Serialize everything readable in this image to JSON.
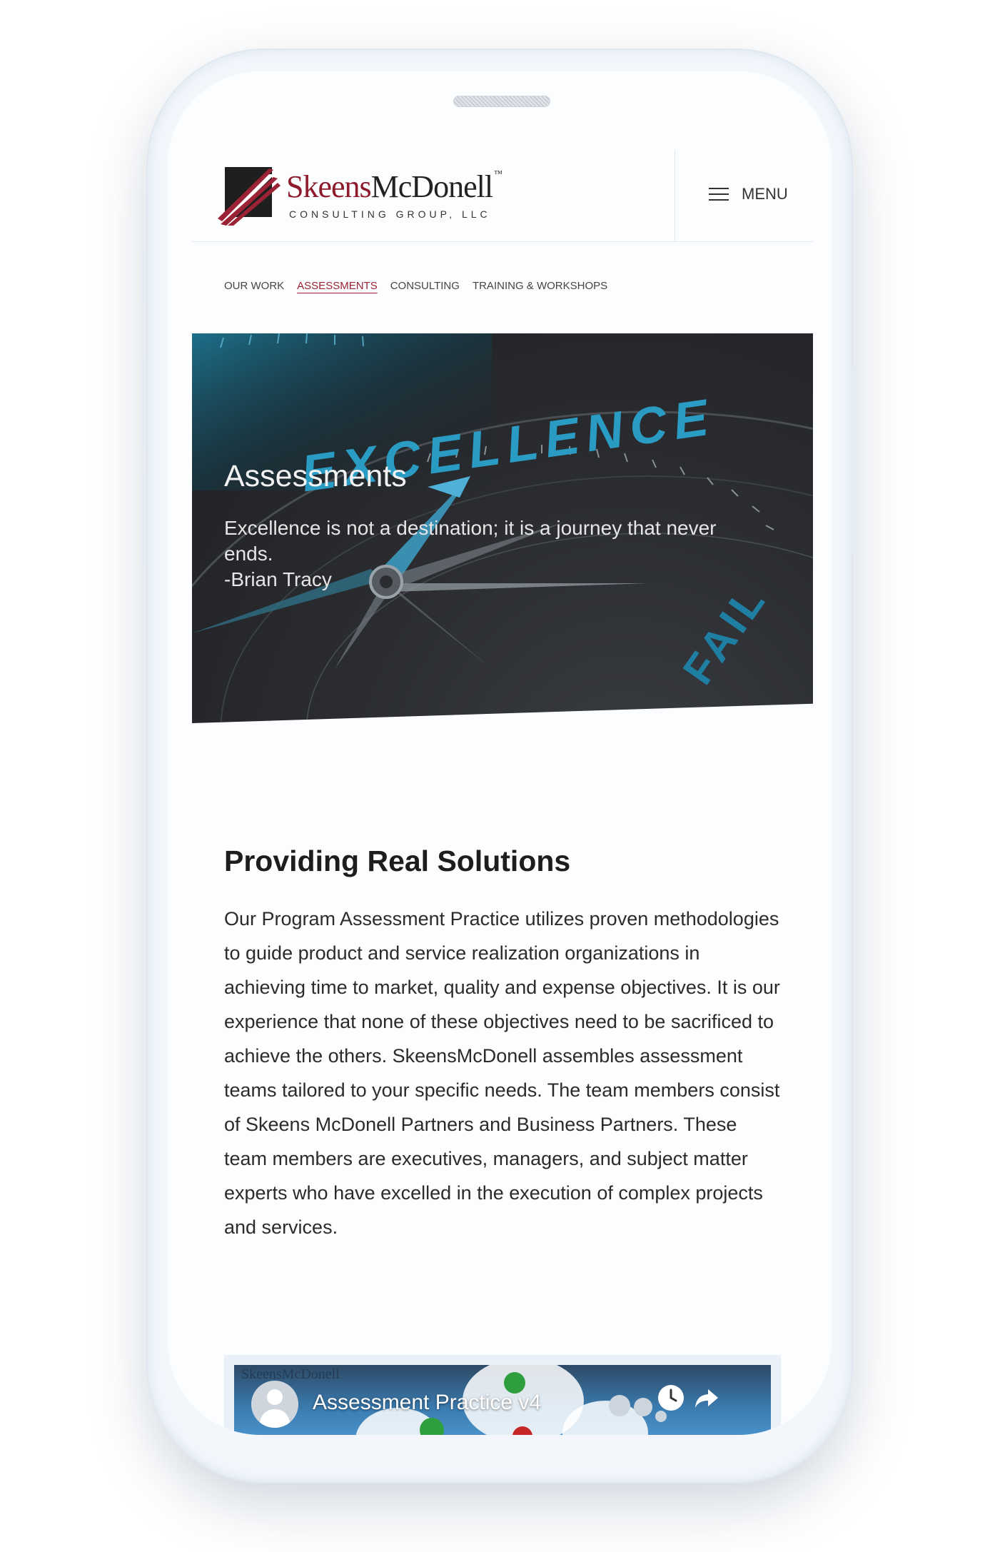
{
  "header": {
    "logo_brand_red": "Skeens",
    "logo_brand_dark": "McDonell",
    "logo_tm": "™",
    "logo_sub": "CONSULTING GROUP, LLC",
    "menu_label": "MENU"
  },
  "subnav": {
    "items": [
      {
        "label": "OUR WORK",
        "active": false
      },
      {
        "label": "ASSESSMENTS",
        "active": true
      },
      {
        "label": "CONSULTING",
        "active": false
      },
      {
        "label": "TRAINING & WORKSHOPS",
        "active": false
      }
    ]
  },
  "hero": {
    "title": "Assessments",
    "quote_line1": "Excellence is not a destination; it is a journey that never",
    "quote_line2": "ends.",
    "quote_author": "-Brian Tracy",
    "dial_word": "EXCELLENCE",
    "dial_word_2": "FAIL"
  },
  "main": {
    "section_title": "Providing Real Solutions",
    "section_body": "Our Program Assessment Practice utilizes proven methodologies to guide product and service realization organizations in achieving time to market, quality and expense objectives. It is our experience that none of these objectives need to be sacrificed to achieve the others. SkeensMcDonell assembles assessment teams tailored to your specific needs. The team members consist of Skeens McDonell Partners and Business Partners. These team members are executives, managers, and subject matter experts who have excelled in the execution of complex projects and services."
  },
  "video": {
    "title": "Assessment Practice v4",
    "logo_text": "SkeensMcDonell"
  },
  "colors": {
    "brand_red": "#8e1b2b",
    "active_link": "#9b2335",
    "teal": "#2aa3c7"
  },
  "icons": [
    "hamburger-icon",
    "clock-icon",
    "share-icon",
    "avatar-icon",
    "compass-needle-icon"
  ]
}
